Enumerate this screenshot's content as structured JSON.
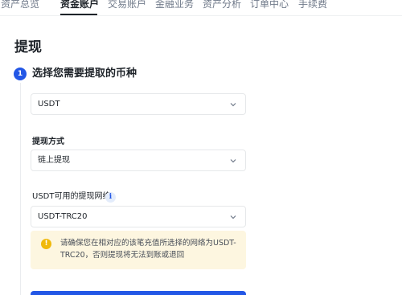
{
  "nav": {
    "tabs": [
      {
        "label": "资产总览"
      },
      {
        "label": "资金账户"
      },
      {
        "label": "交易账户"
      },
      {
        "label": "金融业务"
      },
      {
        "label": "资产分析"
      },
      {
        "label": "订单中心"
      },
      {
        "label": "手续费"
      }
    ],
    "active_index": 1
  },
  "page": {
    "title": "提现"
  },
  "step": {
    "number": "1",
    "title": "选择您需要提取的币种"
  },
  "currency_select": {
    "value": "USDT"
  },
  "method": {
    "label": "提现方式",
    "value": "链上提现"
  },
  "network": {
    "label": "USDT可用的提现网络",
    "info_icon": "i",
    "value": "USDT-TRC20"
  },
  "warning": {
    "icon": "!",
    "text": "请确保您在相对应的该笔充值所选择的网络为USDT-TRC20，否则提现将无法到账或退回"
  },
  "colors": {
    "accent": "#2357e6",
    "warning_bg": "#fdf6e0",
    "warning_icon": "#f0b90b"
  }
}
